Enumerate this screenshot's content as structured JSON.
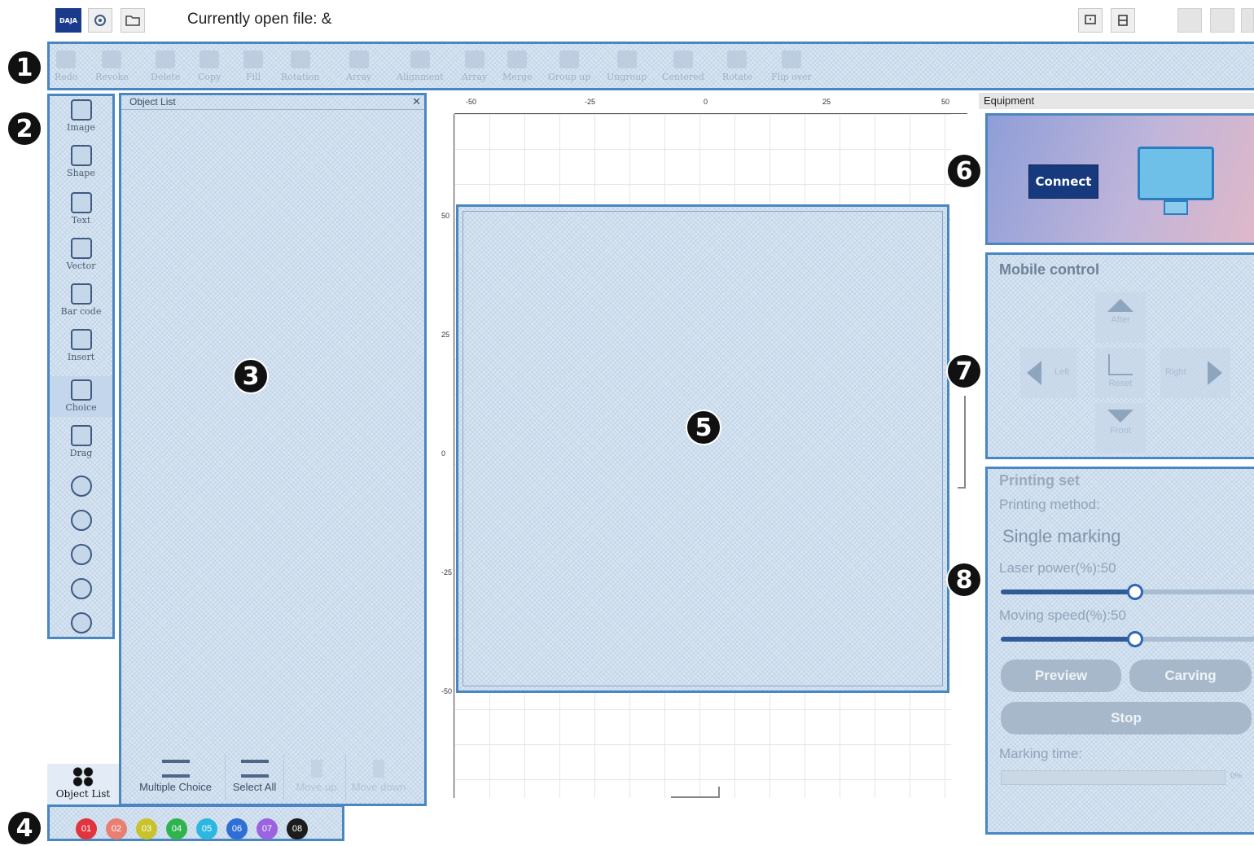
{
  "titlebar": {
    "logo_text": "DAJA",
    "current_file_label": "Currently open file: &"
  },
  "toolbar": {
    "items": [
      "Redo",
      "Revoke",
      "Delete",
      "Copy",
      "Fill",
      "Rotation",
      "Array",
      "Alignment",
      "Array",
      "Merge",
      "Group up",
      "Ungroup",
      "Centered",
      "Rotate",
      "Flip over"
    ]
  },
  "left_tools": {
    "items": [
      "Image",
      "Shape",
      "Text",
      "Vector",
      "Bar code",
      "Insert",
      "Choice",
      "Drag"
    ]
  },
  "object_list": {
    "title": "Object List",
    "close_glyph": "✕",
    "buttons": [
      "Multiple Choice",
      "Select All",
      "Move up",
      "Move down"
    ],
    "tab_label": "Object List"
  },
  "layers": {
    "items": [
      {
        "label": "01",
        "color": "#e0343e"
      },
      {
        "label": "02",
        "color": "#e87f72"
      },
      {
        "label": "03",
        "color": "#c8c22c"
      },
      {
        "label": "04",
        "color": "#2fb34d"
      },
      {
        "label": "05",
        "color": "#2cb7e0"
      },
      {
        "label": "06",
        "color": "#2e6fd6"
      },
      {
        "label": "07",
        "color": "#9b63e0"
      },
      {
        "label": "08",
        "color": "#1c1c1c"
      }
    ]
  },
  "canvas": {
    "ruler_top": [
      "-50",
      "-25",
      "0",
      "25",
      "50"
    ],
    "ruler_left": [
      "50",
      "25",
      "0",
      "-25",
      "-50"
    ]
  },
  "equipment": {
    "title": "Equipment",
    "connect_label": "Connect"
  },
  "mobile_control": {
    "title": "Mobile control",
    "after": "After",
    "left": "Left",
    "reset": "Reset",
    "right": "Right",
    "front": "Front"
  },
  "printing_set": {
    "title": "Printing set",
    "method_label": "Printing method:",
    "method_value": "Single marking",
    "laser_power_label": "Laser power(%):50",
    "laser_power_value": 50,
    "moving_speed_label": "Moving speed(%):50",
    "moving_speed_value": 50,
    "preview_label": "Preview",
    "carving_label": "Carving",
    "stop_label": "Stop",
    "marking_time_label": "Marking time:",
    "progress_text": "0%",
    "progress_value": 0
  },
  "badges": [
    "1",
    "2",
    "3",
    "4",
    "5",
    "6",
    "7",
    "8"
  ]
}
